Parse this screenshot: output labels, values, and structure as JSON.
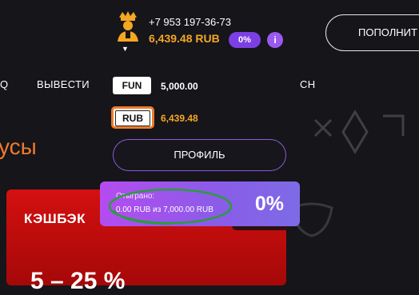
{
  "header": {
    "phone": "+7 953 197-36-73",
    "balance": "6,439.48 RUB",
    "percent_badge": "0%",
    "info_label": "i",
    "topup_label": "ПОПОЛНИТ"
  },
  "nav": {
    "left_fragment": "Q",
    "withdraw": "ВЫВЕСТИ",
    "right_fragment": "СН"
  },
  "currencies": [
    {
      "code": "FUN",
      "amount": "5,000.00"
    },
    {
      "code": "RUB",
      "amount": "6,439.48"
    }
  ],
  "profile_button": "ПРОФИЛЬ",
  "bonus_heading": "усы",
  "cashback_card": {
    "title": "КЭШБЭК",
    "value": "5 – 25 %"
  },
  "wager": {
    "label": "Отыграно:",
    "value": "0.00 RUB из 7,000.00 RUB",
    "percent": "0%"
  },
  "colors": {
    "accent_orange": "#f5a623",
    "accent_purple": "#7b3fe4",
    "cashback_red": "#d41010"
  }
}
